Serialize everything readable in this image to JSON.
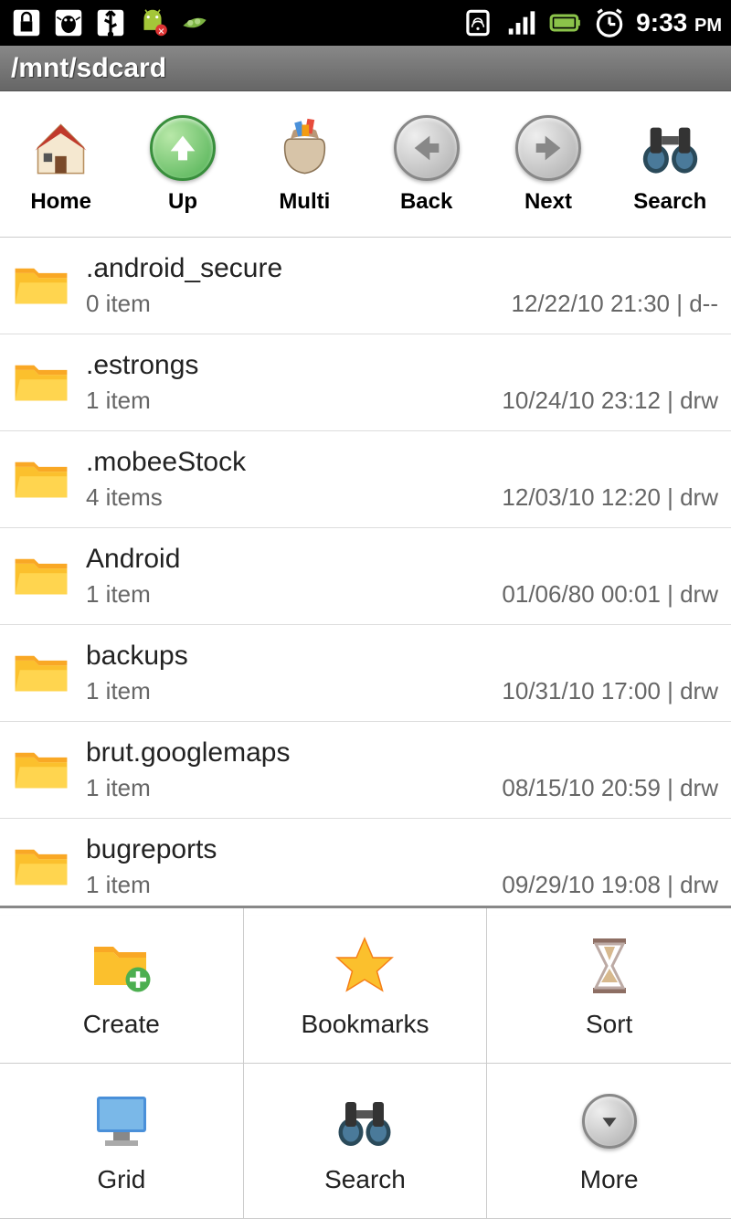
{
  "status": {
    "time": "9:33",
    "ampm": "PM"
  },
  "path": "/mnt/sdcard",
  "toolbar": [
    {
      "label": "Home"
    },
    {
      "label": "Up"
    },
    {
      "label": "Multi"
    },
    {
      "label": "Back"
    },
    {
      "label": "Next"
    },
    {
      "label": "Search"
    }
  ],
  "files": [
    {
      "name": ".android_secure",
      "count": "0 item",
      "date": "12/22/10 21:30",
      "perm": "d--"
    },
    {
      "name": ".estrongs",
      "count": "1 item",
      "date": "10/24/10 23:12",
      "perm": "drw"
    },
    {
      "name": ".mobeeStock",
      "count": "4 items",
      "date": "12/03/10 12:20",
      "perm": "drw"
    },
    {
      "name": "Android",
      "count": "1 item",
      "date": "01/06/80 00:01",
      "perm": "drw"
    },
    {
      "name": "backups",
      "count": "1 item",
      "date": "10/31/10 17:00",
      "perm": "drw"
    },
    {
      "name": "brut.googlemaps",
      "count": "1 item",
      "date": "08/15/10 20:59",
      "perm": "drw"
    },
    {
      "name": "bugreports",
      "count": "1 item",
      "date": "09/29/10 19:08",
      "perm": "drw"
    }
  ],
  "menu": [
    {
      "label": "Create"
    },
    {
      "label": "Bookmarks"
    },
    {
      "label": "Sort"
    },
    {
      "label": "Grid"
    },
    {
      "label": "Search"
    },
    {
      "label": "More"
    }
  ]
}
